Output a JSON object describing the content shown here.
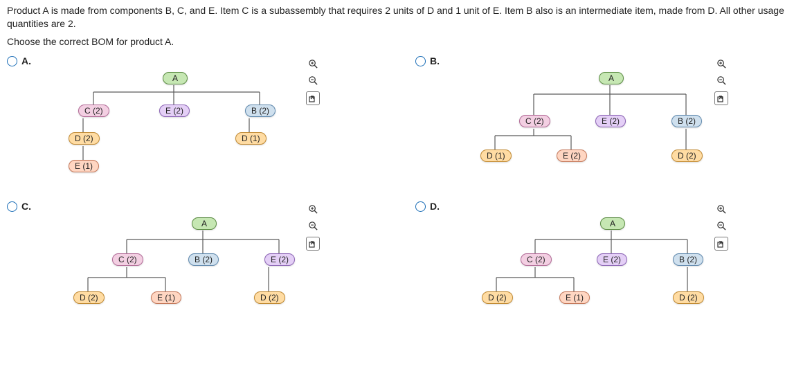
{
  "question_text": "Product A is made from components B, C, and E. Item C is a subassembly that requires 2 units of D and 1 unit of E. Item B also is an intermediate item, made from D. All other usage quantities are 2.",
  "prompt_text": "Choose the correct BOM for product A.",
  "labels": {
    "A": "A.",
    "B": "B.",
    "C": "C.",
    "D": "D."
  },
  "nodes": {
    "A": "A",
    "C2": "C (2)",
    "E2": "E (2)",
    "B2": "B (2)",
    "D2": "D (2)",
    "D1": "D (1)",
    "E1": "E (1)"
  },
  "icons": {
    "zoom_in": "zoom-in-icon",
    "zoom_out": "zoom-out-icon",
    "popout": "popout-icon"
  }
}
